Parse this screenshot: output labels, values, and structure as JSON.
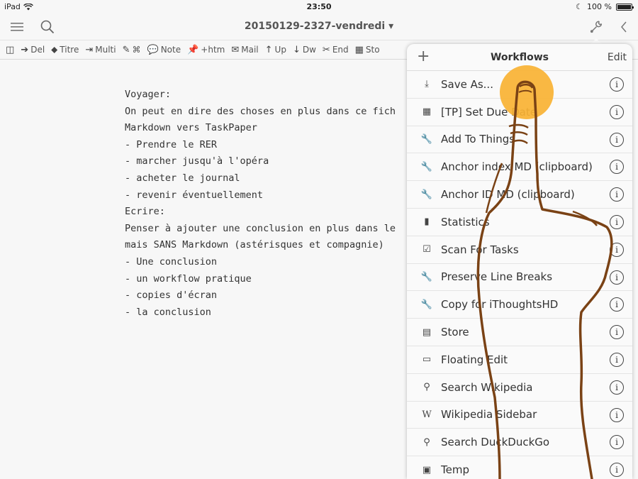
{
  "status": {
    "device": "iPad",
    "time": "23:50",
    "battery": "100 %"
  },
  "navbar": {
    "title": "20150129-2327-vendredi ▾"
  },
  "toolbar": [
    {
      "icon": "book-icon",
      "glyph": "◫",
      "label": ""
    },
    {
      "icon": "arrow-circle-icon",
      "glyph": "➔",
      "label": "Del"
    },
    {
      "icon": "tag-icon",
      "glyph": "⬥",
      "label": "Titre"
    },
    {
      "icon": "export-icon",
      "glyph": "⇥",
      "label": "Multi"
    },
    {
      "icon": "edit-icon",
      "glyph": "✎",
      "label": "⌘"
    },
    {
      "icon": "comment-icon",
      "glyph": "💬",
      "label": "Note"
    },
    {
      "icon": "pin-icon",
      "glyph": "📌",
      "label": "+htm"
    },
    {
      "icon": "mail-icon",
      "glyph": "✉",
      "label": "Mail"
    },
    {
      "icon": "arrow-up-icon",
      "glyph": "↑",
      "label": "Up"
    },
    {
      "icon": "arrow-down-icon",
      "glyph": "↓",
      "label": "Dw"
    },
    {
      "icon": "scissors-icon",
      "glyph": "✂",
      "label": "End"
    },
    {
      "icon": "register-icon",
      "glyph": "▦",
      "label": "Sto"
    }
  ],
  "editor": {
    "lines": [
      "Voyager:",
      "On peut en dire des choses en plus dans ce fich",
      "Markdown vers TaskPaper",
      "- Prendre le RER",
      "- marcher jusqu'à l'opéra",
      "- acheter le journal",
      "- revenir éventuellement",
      "Ecrire:",
      "Penser à ajouter une conclusion en plus dans le",
      "mais SANS Markdown (astérisques et compagnie)",
      "- Une conclusion",
      "- un workflow pratique",
      "- copies d'écran",
      "- la conclusion"
    ]
  },
  "popover": {
    "add": "+",
    "title": "Workflows",
    "edit": "Edit",
    "items": [
      {
        "label": "Save As...",
        "icon": "download-icon",
        "glyph": "⤓"
      },
      {
        "label": "[TP] Set Due Date",
        "icon": "calendar-icon",
        "glyph": "▦"
      },
      {
        "label": "Add To Things",
        "icon": "wrench-icon",
        "glyph": "🔧"
      },
      {
        "label": "Anchor index MD (clipboard)",
        "icon": "wrench-icon",
        "glyph": "🔧"
      },
      {
        "label": "Anchor ID MD (clipboard)",
        "icon": "wrench-icon",
        "glyph": "🔧"
      },
      {
        "label": "Statistics",
        "icon": "bar-chart-icon",
        "glyph": "▮"
      },
      {
        "label": "Scan For Tasks",
        "icon": "checklist-icon",
        "glyph": "☑"
      },
      {
        "label": "Preserve Line Breaks",
        "icon": "wrench-icon",
        "glyph": "🔧"
      },
      {
        "label": "Copy for iThoughtsHD",
        "icon": "wrench-icon",
        "glyph": "🔧"
      },
      {
        "label": "Store",
        "icon": "cash-register-icon",
        "glyph": "▤"
      },
      {
        "label": "Floating Edit",
        "icon": "comment-icon",
        "glyph": "▭"
      },
      {
        "label": "Search Wikipedia",
        "icon": "search-icon",
        "glyph": "⚲"
      },
      {
        "label": "Wikipedia Sidebar",
        "icon": "wikipedia-icon",
        "glyph": "W"
      },
      {
        "label": "Search DuckDuckGo",
        "icon": "search-icon",
        "glyph": "⚲"
      },
      {
        "label": "Temp",
        "icon": "clipboard-icon",
        "glyph": "▣"
      }
    ]
  }
}
